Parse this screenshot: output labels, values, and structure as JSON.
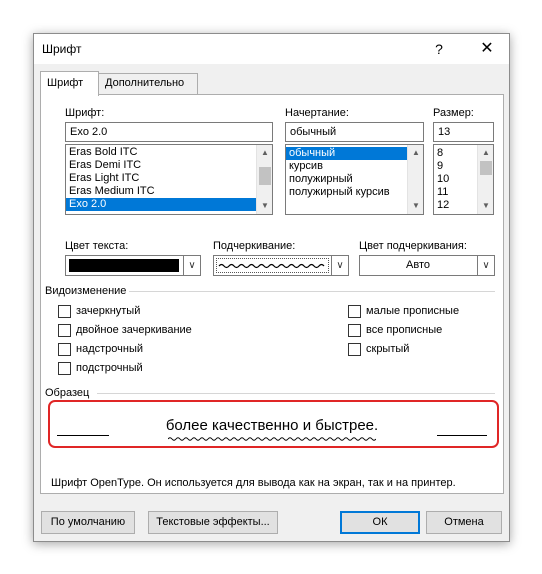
{
  "window": {
    "title": "Шрифт",
    "help_label": "?",
    "close_label": "✕"
  },
  "tabs": [
    {
      "label": "Шрифт",
      "active": true
    },
    {
      "label": "Дополнительно",
      "active": false
    }
  ],
  "font": {
    "label": "Шрифт:",
    "value": "Exo 2.0",
    "items": [
      "Eras Bold ITC",
      "Eras Demi ITC",
      "Eras Light ITC",
      "Eras Medium ITC",
      "Exo 2.0"
    ],
    "selected": "Exo 2.0"
  },
  "style": {
    "label": "Начертание:",
    "value": "обычный",
    "items": [
      "обычный",
      "курсив",
      "полужирный",
      "полужирный курсив"
    ],
    "selected": "обычный"
  },
  "size": {
    "label": "Размер:",
    "value": "13",
    "items": [
      "8",
      "9",
      "10",
      "11",
      "12"
    ]
  },
  "font_color": {
    "label": "Цвет текста:",
    "color": "#000000"
  },
  "underline_style": {
    "label": "Подчеркивание:",
    "value_icon": "wavy-underline"
  },
  "underline_color": {
    "label": "Цвет подчеркивания:",
    "value": "Авто"
  },
  "effects": {
    "label": "Видоизменение",
    "left": [
      {
        "label": "зачеркнутый",
        "checked": false
      },
      {
        "label": "двойное зачеркивание",
        "checked": false
      },
      {
        "label": "надстрочный",
        "checked": false
      },
      {
        "label": "подстрочный",
        "checked": false
      }
    ],
    "right": [
      {
        "label": "малые прописные",
        "checked": false
      },
      {
        "label": "все прописные",
        "checked": false
      },
      {
        "label": "скрытый",
        "checked": false
      }
    ]
  },
  "preview": {
    "label": "Образец",
    "text": "более качественно и быстрее.",
    "description": "Шрифт OpenType. Он используется для вывода как на экран, так и на принтер."
  },
  "buttons": {
    "default": "По умолчанию",
    "text_effects": "Текстовые эффекты...",
    "ok": "ОК",
    "cancel": "Отмена"
  },
  "colors": {
    "accent": "#0078d7",
    "highlight": "#e02626"
  }
}
